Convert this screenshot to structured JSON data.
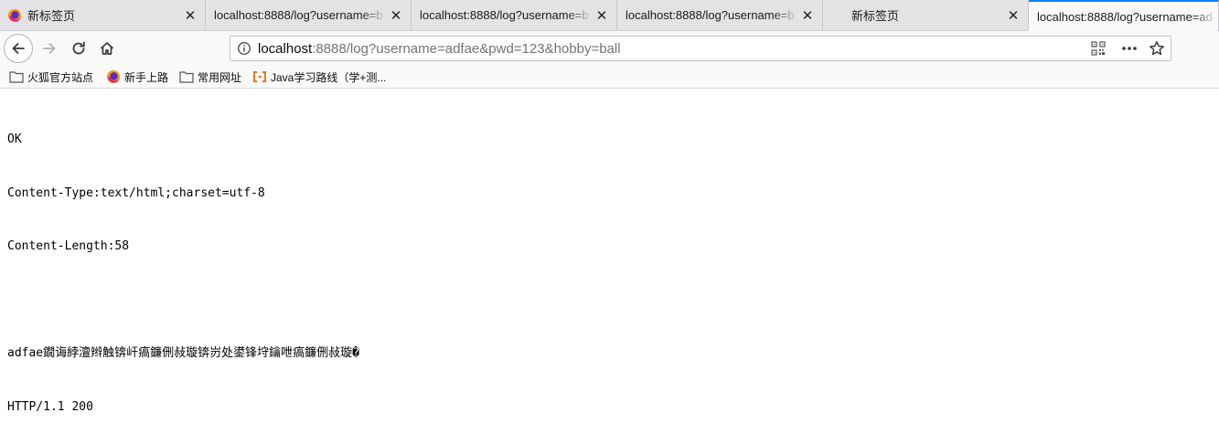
{
  "tabs": [
    {
      "title": "新标签页",
      "favicon": "firefox-icon"
    },
    {
      "title": "localhost:8888/log?username=b",
      "favicon": "none"
    },
    {
      "title": "localhost:8888/log?username=b",
      "favicon": "none"
    },
    {
      "title": "localhost:8888/log?username=b",
      "favicon": "none"
    },
    {
      "title": "新标签页",
      "favicon": "none"
    },
    {
      "title": "localhost:8888/log?username=ad",
      "favicon": "none",
      "active": true
    }
  ],
  "toolbar": {
    "url_host": "localhost",
    "url_rest": ":8888/log?username=adfae&pwd=123&hobby=ball"
  },
  "bookmarks": [
    {
      "label": "火狐官方站点",
      "icon": "folder-icon"
    },
    {
      "label": "新手上路",
      "icon": "firefox-icon"
    },
    {
      "label": "常用网址",
      "icon": "folder-icon"
    },
    {
      "label": "Java学习路线（学+测...",
      "icon": "bracket-logo-icon"
    }
  ],
  "response": {
    "lines": [
      "OK",
      "Content-Type:text/html;charset=utf-8",
      "Content-Length:58",
      "",
      "adfae鐗诲綍澶辫触锛屽瘑鐮侀敊璇锛岃处鍙锋垨鑰呭瘑鐮侀敊璇�",
      "HTTP/1.1 200"
    ]
  },
  "colors": {
    "accent": "#0a84ff",
    "tabbar": "#e3e3e6",
    "toolbar": "#f9f9fa"
  }
}
